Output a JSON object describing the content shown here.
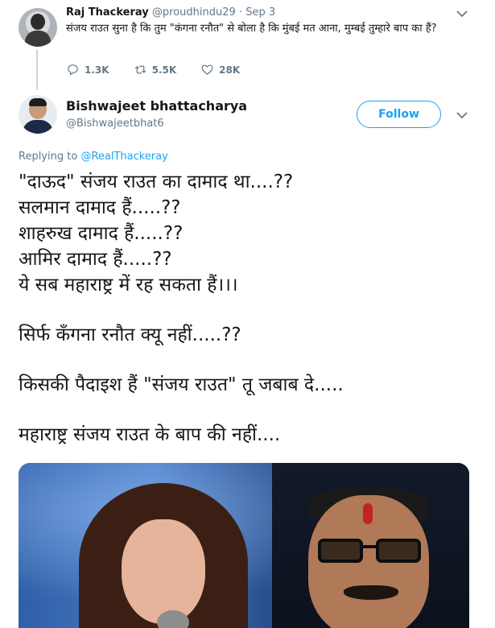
{
  "parent_tweet": {
    "name": "Raj Thackeray",
    "handle": "@proudhindu29",
    "separator": "·",
    "time": "Sep 3",
    "text": "संजय राउत सुना है कि तुम \"कंगना रनौत\" से बोला है कि मुंबई मत आना, मुम्बई तुम्हारे बाप का हैं?",
    "actions": {
      "replies": "1.3K",
      "retweets": "5.5K",
      "likes": "28K"
    }
  },
  "main_tweet": {
    "name": "Bishwajeet bhattacharya",
    "handle": "@Bishwajeetbhat6",
    "follow_label": "Follow",
    "replying_prefix": "Replying to",
    "replying_mention": "@RealThackeray",
    "lines": [
      "\"दाऊद\" संजय राउत का दामाद था....??",
      "सलमान दामाद हैं.....??",
      "शाहरुख दामाद हैं.....??",
      "आमिर दामाद हैं.....??",
      "ये सब महाराष्ट्र में रह सकता हैं।।।",
      "सिर्फ कँगना रनौत क्यू नहीं.....??",
      "किसकी पैदाइश हैं \"संजय राउत\" तू जबाब दे.....",
      "महाराष्ट्र संजय राउत के बाप की नहीं...."
    ]
  },
  "colors": {
    "accent": "#1da1f2",
    "secondary_text": "#657786",
    "primary_text": "#14171a"
  },
  "icons": [
    "reply-icon",
    "retweet-icon",
    "like-icon",
    "chevron-down-icon"
  ]
}
